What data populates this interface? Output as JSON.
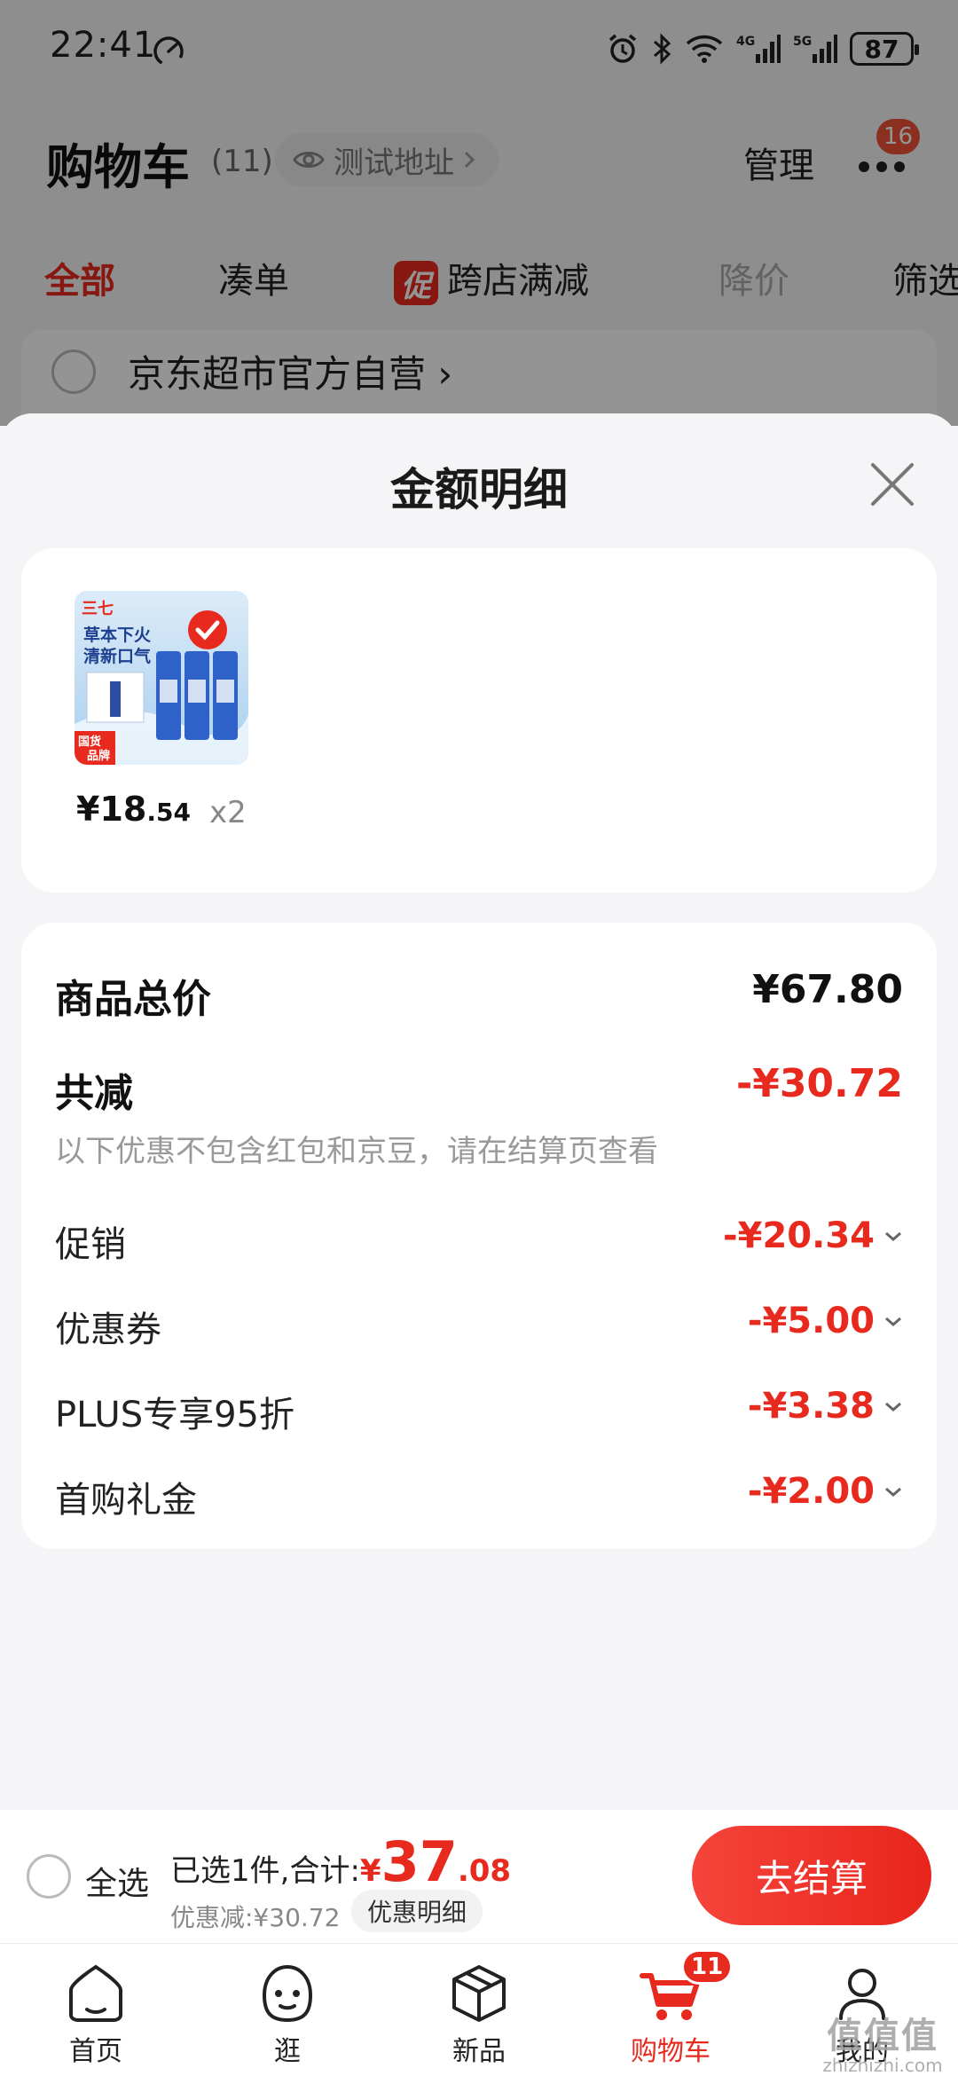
{
  "status_bar": {
    "time": "22:41",
    "battery": "87"
  },
  "header": {
    "title": "购物车",
    "count": "(11)",
    "address": "测试地址",
    "manage": "管理",
    "more_badge": "16"
  },
  "filters": [
    {
      "label": "全部"
    },
    {
      "label": "凑单"
    },
    {
      "label": "跨店满减",
      "tag": "促"
    },
    {
      "label": "降价"
    },
    {
      "label": "筛选"
    }
  ],
  "store": {
    "name": "京东超市官方自营 ›"
  },
  "sheet": {
    "title": "金额明细",
    "product": {
      "price_int": "¥18",
      "price_dec": ".54",
      "qty": "x2",
      "image_text_1": "草本下火",
      "image_text_2": "清新口气",
      "image_badge_1": "国货",
      "image_badge_2": "品牌",
      "image_brand": "三七"
    },
    "total_label": "商品总价",
    "total_amount": "¥67.80",
    "reduce_label": "共减",
    "reduce_amount": "-¥30.72",
    "reduce_hint": "以下优惠不包含红包和京豆，请在结算页查看",
    "details": [
      {
        "label": "促销",
        "amount": "-¥20.34"
      },
      {
        "label": "优惠券",
        "amount": "-¥5.00"
      },
      {
        "label": "PLUS专享95折",
        "amount": "-¥3.38"
      },
      {
        "label": "首购礼金",
        "amount": "-¥2.00"
      }
    ]
  },
  "checkout": {
    "select_all": "全选",
    "summary_prefix": "已选1件,合计:",
    "currency": "¥",
    "total_int": "37",
    "total_dec": ".08",
    "discount": "优惠减:¥30.72",
    "detail_button": "优惠明细",
    "pay_button": "去结算"
  },
  "tab_bar": {
    "items": [
      {
        "label": "首页",
        "icon": "home-icon"
      },
      {
        "label": "逛",
        "icon": "face-icon"
      },
      {
        "label": "新品",
        "icon": "box-icon"
      },
      {
        "label": "购物车",
        "icon": "cart-icon",
        "badge": "11"
      },
      {
        "label": "我的",
        "icon": "profile-icon"
      }
    ]
  },
  "watermark": {
    "text": "值值值",
    "url": "zhizhizhi.com"
  },
  "colors": {
    "accent": "#e8291e",
    "background": "#f5f5f7"
  }
}
